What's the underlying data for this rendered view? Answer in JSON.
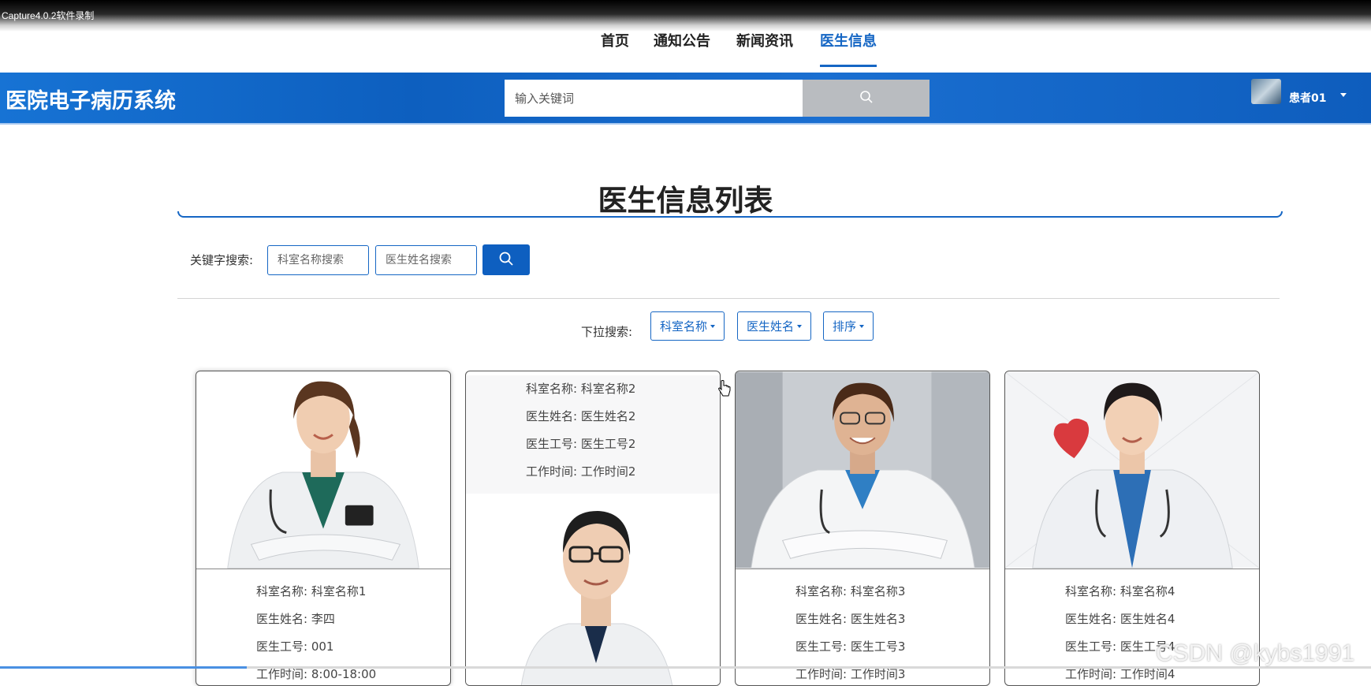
{
  "recording_label": "Capture4.0.2软件录制",
  "nav": {
    "items": [
      {
        "label": "首页"
      },
      {
        "label": "通知公告"
      },
      {
        "label": "新闻资讯"
      },
      {
        "label": "医生信息",
        "active": true
      }
    ]
  },
  "header": {
    "title": "医院电子病历系统",
    "search_placeholder": "输入关键词",
    "user_name": "患者01"
  },
  "page": {
    "title": "医生信息列表"
  },
  "keyword_search": {
    "label": "关键字搜索:",
    "dept_placeholder": "科室名称搜索",
    "name_placeholder": "医生姓名搜索"
  },
  "dropdown_search": {
    "label": "下拉搜索:",
    "options": [
      "科室名称",
      "医生姓名",
      "排序"
    ]
  },
  "doctors": [
    {
      "dept_key": "科室名称:",
      "dept": "科室名称1",
      "name_key": "医生姓名:",
      "name": "李四",
      "id_key": "医生工号:",
      "id": "001",
      "time_key": "工作时间:",
      "time": "8:00-18:00"
    },
    {
      "dept_key": "科室名称:",
      "dept": "科室名称2",
      "name_key": "医生姓名:",
      "name": "医生姓名2",
      "id_key": "医生工号:",
      "id": "医生工号2",
      "time_key": "工作时间:",
      "time": "工作时间2"
    },
    {
      "dept_key": "科室名称:",
      "dept": "科室名称3",
      "name_key": "医生姓名:",
      "name": "医生姓名3",
      "id_key": "医生工号:",
      "id": "医生工号3",
      "time_key": "工作时间:",
      "time": "工作时间3"
    },
    {
      "dept_key": "科室名称:",
      "dept": "科室名称4",
      "name_key": "医生姓名:",
      "name": "医生姓名4",
      "id_key": "医生工号:",
      "id": "医生工号4",
      "time_key": "工作时间:",
      "time": "工作时间4"
    }
  ],
  "watermark": "CSDN @kybs1991",
  "colors": {
    "primary": "#1566c4",
    "header_bg": "#0d5fbf",
    "search_btn": "#b9bcc0"
  },
  "playback_progress": 0.18
}
